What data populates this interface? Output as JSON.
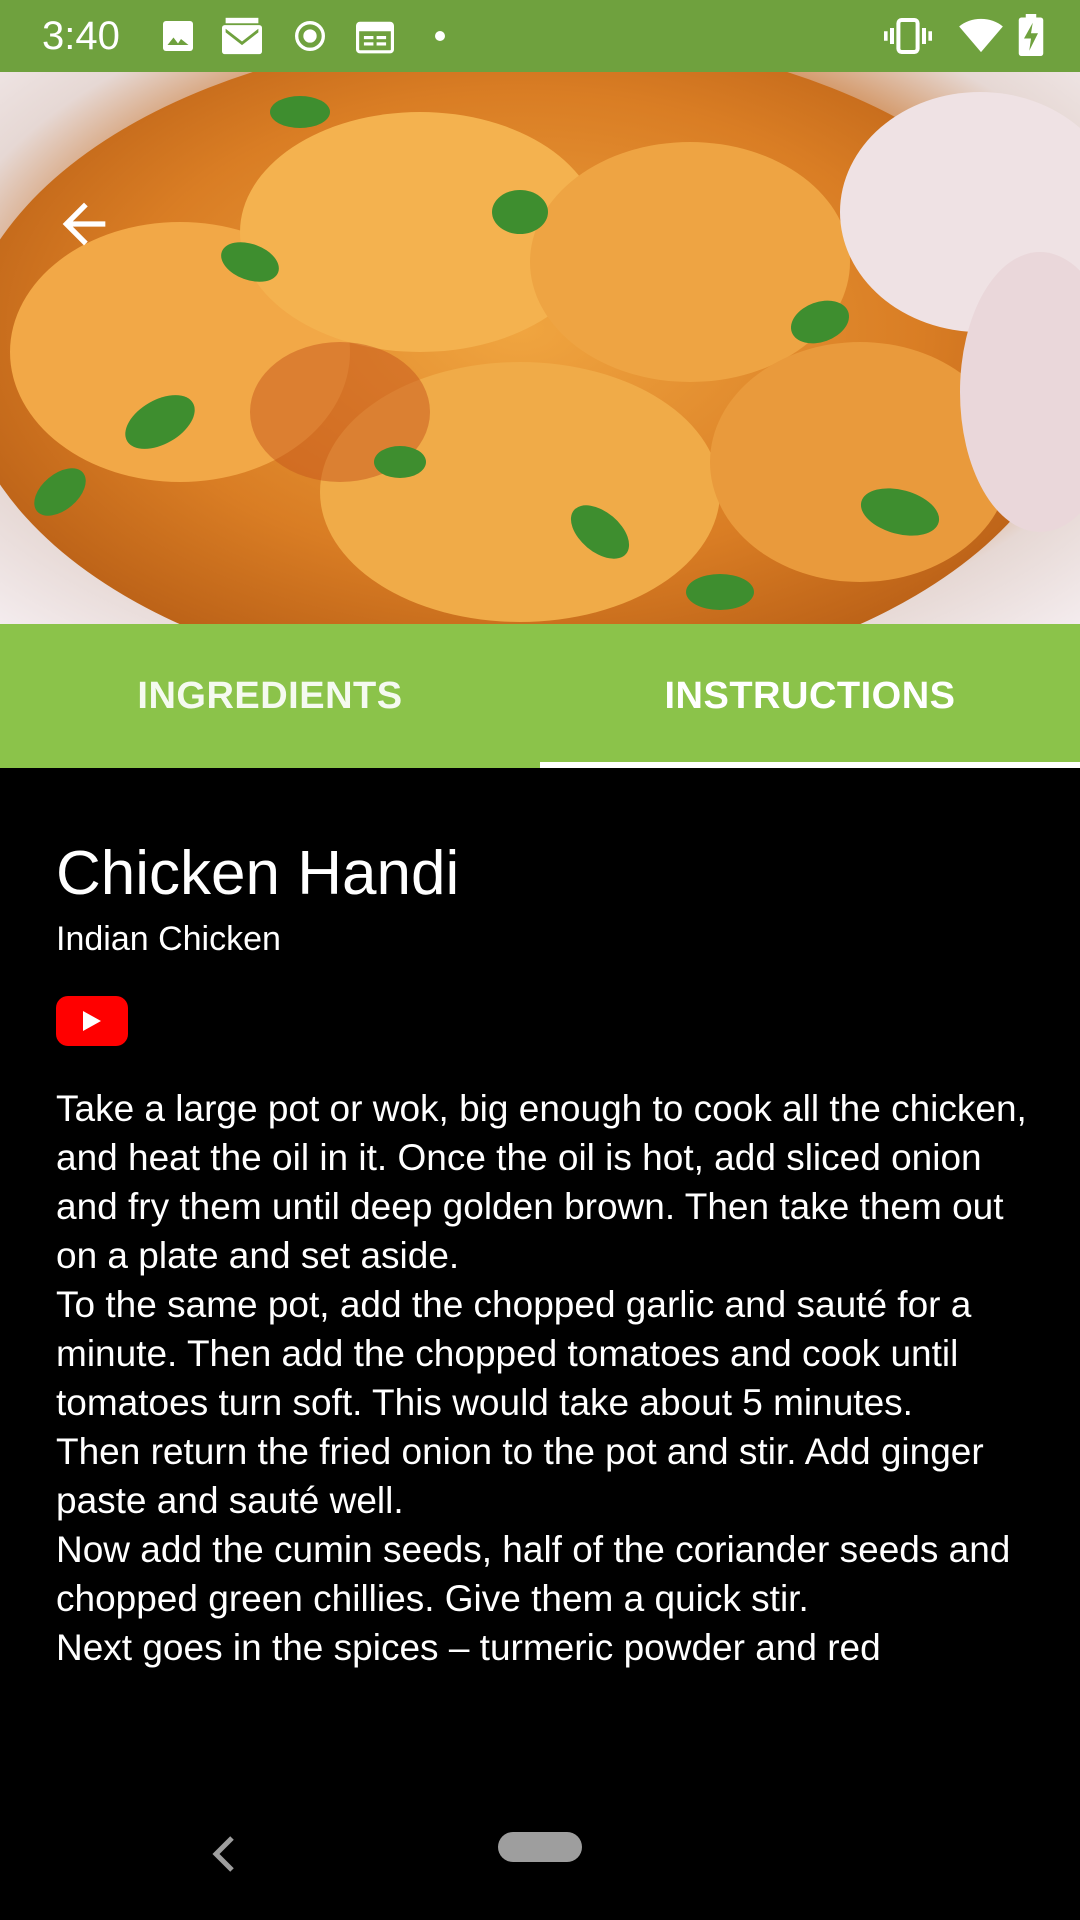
{
  "status_bar": {
    "time": "3:40",
    "left_icons": [
      "image-icon",
      "gmail-icon",
      "radio-icon",
      "calendar-icon",
      "dot-icon"
    ],
    "right_icons": [
      "vibrate-icon",
      "wifi-icon",
      "battery-charging-icon"
    ],
    "color": "#6fa13e"
  },
  "hero": {
    "image_name": "chicken-handi-photo",
    "back_icon": "arrow-back-icon"
  },
  "tabs": [
    {
      "label": "INGREDIENTS",
      "selected": false
    },
    {
      "label": "INSTRUCTIONS",
      "selected": true
    }
  ],
  "recipe": {
    "title": "Chicken Handi",
    "subtitle": "Indian Chicken",
    "video_icon": "youtube-icon",
    "instructions": "Take a large pot or wok, big enough to cook all the chicken, and heat the oil in it. Once the oil is hot, add sliced onion and fry them until deep golden brown. Then take them out on a plate and set aside.\nTo the same pot, add the chopped garlic and sauté for a minute. Then add the chopped tomatoes and cook until tomatoes turn soft. This would take about 5 minutes.\nThen return the fried onion to the pot and stir. Add ginger paste and sauté well.\nNow add the cumin seeds, half of the coriander seeds and chopped green chillies. Give them a quick stir.\nNext goes in the spices – turmeric powder and red"
  },
  "colors": {
    "tab_bar": "#8bc34a",
    "youtube": "#ff0000",
    "background": "#000000"
  },
  "nav_bar": {
    "back_icon": "nav-back-icon",
    "home_icon": "nav-home-pill"
  }
}
